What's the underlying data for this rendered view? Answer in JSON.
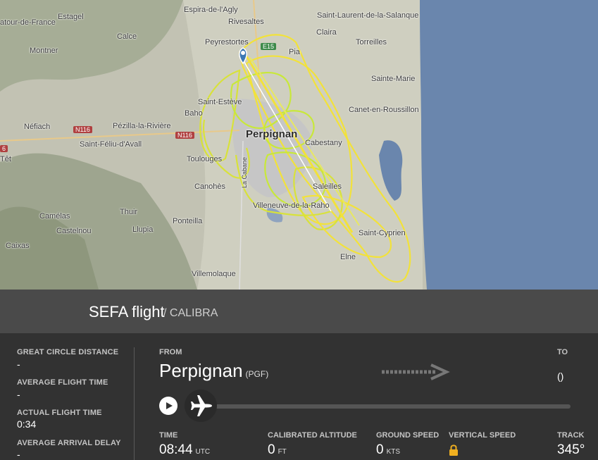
{
  "map": {
    "places": [
      {
        "name": "Estagel"
      },
      {
        "name": "Espira-de-l'Agly"
      },
      {
        "name": "Saint-Laurent-de-la-Salanque"
      },
      {
        "name": "atour-de-France"
      },
      {
        "name": "Rivesaltes"
      },
      {
        "name": "Claira"
      },
      {
        "name": "Calce"
      },
      {
        "name": "Peyrestortes"
      },
      {
        "name": "Torreilles"
      },
      {
        "name": "Montner"
      },
      {
        "name": "Pia"
      },
      {
        "name": "Sainte-Marie"
      },
      {
        "name": "Saint-Estève"
      },
      {
        "name": "Baho"
      },
      {
        "name": "Canet-en-Roussillon"
      },
      {
        "name": "Néfiach"
      },
      {
        "name": "Pézilla-la-Rivière"
      },
      {
        "name": "Perpignan"
      },
      {
        "name": "Saint-Féliu-d'Avall"
      },
      {
        "name": "Cabestany"
      },
      {
        "name": "Têt"
      },
      {
        "name": "Toulouges"
      },
      {
        "name": "La Cabane"
      },
      {
        "name": "Canohès"
      },
      {
        "name": "Saleilles"
      },
      {
        "name": "Villeneuve-de-la-Raho"
      },
      {
        "name": "Thuir"
      },
      {
        "name": "Camélas"
      },
      {
        "name": "Ponteilla"
      },
      {
        "name": "Saint-Cyprien"
      },
      {
        "name": "Castelnou"
      },
      {
        "name": "Llupia"
      },
      {
        "name": "Caixas"
      },
      {
        "name": "Elne"
      },
      {
        "name": "Villemolaque"
      }
    ],
    "roads": [
      "E15",
      "N116",
      "N116",
      "6"
    ]
  },
  "flight": {
    "title": "SEFA flight",
    "subtitle": "/ CALIBRA"
  },
  "stats": {
    "great_circle_label": "GREAT CIRCLE DISTANCE",
    "great_circle_value": "-",
    "avg_flight_time_label": "AVERAGE FLIGHT TIME",
    "avg_flight_time_value": "-",
    "actual_flight_time_label": "ACTUAL FLIGHT TIME",
    "actual_flight_time_value": "0:34",
    "avg_arrival_delay_label": "AVERAGE ARRIVAL DELAY",
    "avg_arrival_delay_value": "-"
  },
  "route": {
    "from_label": "FROM",
    "from_city": "Perpignan",
    "from_code": "(PGF)",
    "to_label": "TO",
    "to_value": "()"
  },
  "telemetry": {
    "time_label": "TIME",
    "time_value": "08:44",
    "time_unit": "UTC",
    "alt_label": "CALIBRATED ALTITUDE",
    "alt_value": "0",
    "alt_unit": "FT",
    "gs_label": "GROUND SPEED",
    "gs_value": "0",
    "gs_unit": "KTS",
    "vs_label": "VERTICAL SPEED",
    "track_label": "TRACK",
    "track_value": "345°"
  },
  "colors": {
    "sea": "#6a86ad",
    "track_yellow": "#f2e23a",
    "track_green": "#c8e83a",
    "lock": "#f0b020"
  }
}
